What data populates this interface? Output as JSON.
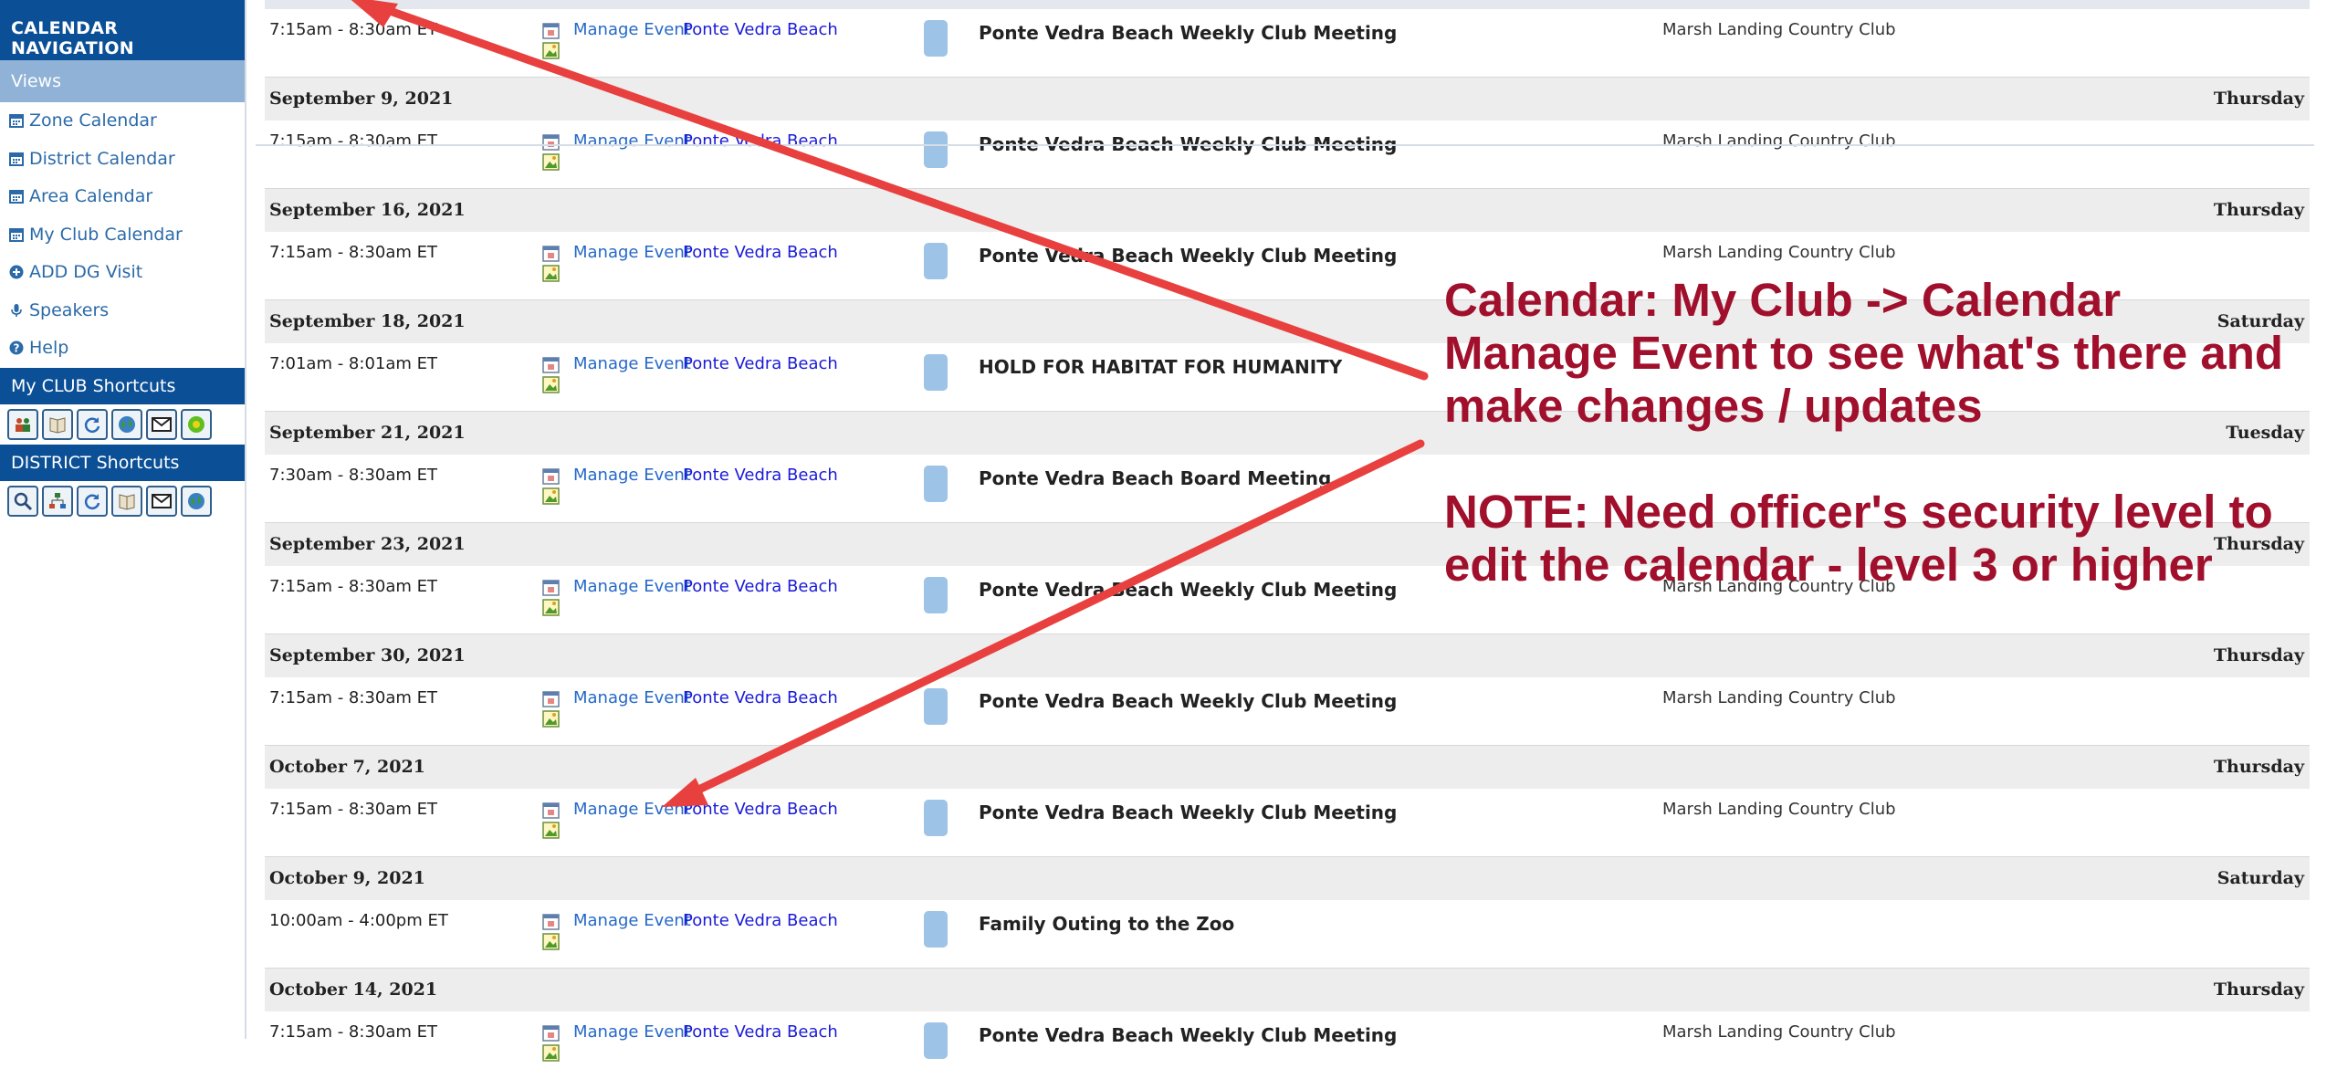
{
  "sidebar": {
    "title": "CALENDAR NAVIGATION",
    "views_label": "Views",
    "items": [
      {
        "label": "Zone Calendar",
        "icon": "calendar-icon"
      },
      {
        "label": "District Calendar",
        "icon": "calendar-icon"
      },
      {
        "label": "Area Calendar",
        "icon": "calendar-icon"
      },
      {
        "label": "My Club Calendar",
        "icon": "calendar-icon"
      },
      {
        "label": "ADD DG Visit",
        "icon": "plus-circle-icon"
      },
      {
        "label": "Speakers",
        "icon": "microphone-icon"
      },
      {
        "label": "Help",
        "icon": "question-circle-icon"
      }
    ],
    "club_shortcuts_label": "My CLUB Shortcuts",
    "district_shortcuts_label": "DISTRICT Shortcuts"
  },
  "colors": {
    "nav_blue": "#0b4f96",
    "views_blue": "#8fb2d6",
    "link_blue": "#2468c8",
    "club_link": "#1a1ad8",
    "event_swatch": "#9dc3e6",
    "annotation_red": "#a0102c",
    "arrow_red": "#e8403e"
  },
  "events": [
    {
      "date": "",
      "weekday": "",
      "time": "7:15am - 8:30am ET",
      "manage": "Manage Event",
      "club": "Ponte Vedra Beach",
      "title": "Ponte Vedra Beach Weekly Club Meeting",
      "location": "Marsh Landing Country Club"
    },
    {
      "date": "September 9, 2021",
      "weekday": "Thursday",
      "time": "7:15am - 8:30am ET",
      "manage": "Manage Event",
      "club": "Ponte Vedra Beach",
      "title": "Ponte Vedra Beach Weekly Club Meeting",
      "location": "Marsh Landing Country Club"
    },
    {
      "date": "September 16, 2021",
      "weekday": "Thursday",
      "time": "7:15am - 8:30am ET",
      "manage": "Manage Event",
      "club": "Ponte Vedra Beach",
      "title": "Ponte Vedra Beach Weekly Club Meeting",
      "location": "Marsh Landing Country Club"
    },
    {
      "date": "September 18, 2021",
      "weekday": "Saturday",
      "time": "7:01am - 8:01am ET",
      "manage": "Manage Event",
      "club": "Ponte Vedra Beach",
      "title": "HOLD FOR HABITAT FOR HUMANITY",
      "location": ""
    },
    {
      "date": "September 21, 2021",
      "weekday": "Tuesday",
      "time": "7:30am - 8:30am ET",
      "manage": "Manage Event",
      "club": "Ponte Vedra Beach",
      "title": "Ponte Vedra Beach Board Meeting",
      "location": ""
    },
    {
      "date": "September 23, 2021",
      "weekday": "Thursday",
      "time": "7:15am - 8:30am ET",
      "manage": "Manage Event",
      "club": "Ponte Vedra Beach",
      "title": "Ponte Vedra Beach Weekly Club Meeting",
      "location": "Marsh Landing Country Club"
    },
    {
      "date": "September 30, 2021",
      "weekday": "Thursday",
      "time": "7:15am - 8:30am ET",
      "manage": "Manage Event",
      "club": "Ponte Vedra Beach",
      "title": "Ponte Vedra Beach Weekly Club Meeting",
      "location": "Marsh Landing Country Club"
    },
    {
      "date": "October 7, 2021",
      "weekday": "Thursday",
      "time": "7:15am - 8:30am ET",
      "manage": "Manage Event",
      "club": "Ponte Vedra Beach",
      "title": "Ponte Vedra Beach Weekly Club Meeting",
      "location": "Marsh Landing Country Club"
    },
    {
      "date": "October 9, 2021",
      "weekday": "Saturday",
      "time": "10:00am - 4:00pm ET",
      "manage": "Manage Event",
      "club": "Ponte Vedra Beach",
      "title": "Family Outing to the Zoo",
      "location": ""
    },
    {
      "date": "October 14, 2021",
      "weekday": "Thursday",
      "time": "7:15am - 8:30am ET",
      "manage": "Manage Event",
      "club": "Ponte Vedra Beach",
      "title": "Ponte Vedra Beach Weekly Club Meeting",
      "location": "Marsh Landing Country Club"
    }
  ],
  "annotation": {
    "line1": "Calendar: My Club -> Calendar",
    "line2": "Manage Event to see what's there and",
    "line3": "make changes / updates",
    "line4": "NOTE: Need officer's security level to",
    "line5": "edit the calendar - level 3 or higher"
  }
}
